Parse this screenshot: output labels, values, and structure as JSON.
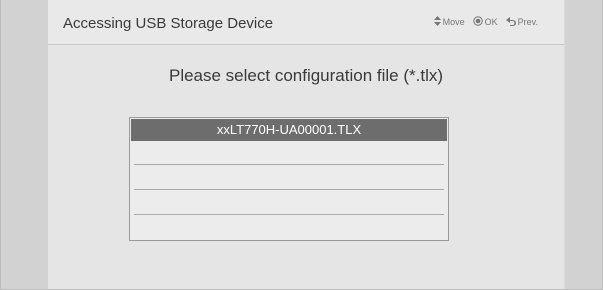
{
  "header": {
    "title": "Accessing USB Storage Device",
    "hints": [
      {
        "icon": "up-down-arrows-icon",
        "label": "Move"
      },
      {
        "icon": "ok-circle-icon",
        "label": "OK"
      },
      {
        "icon": "back-arrow-icon",
        "label": "Prev."
      }
    ]
  },
  "prompt": "Please select configuration file (*.tlx)",
  "files": {
    "selected_index": 0,
    "items": [
      "xxLT770H-UA00001.TLX",
      "",
      "",
      "",
      ""
    ]
  },
  "colors": {
    "selected_bg": "#6d6d6d",
    "panel_bg": "#e5e5e5",
    "side_bg": "#d2d2d2"
  }
}
